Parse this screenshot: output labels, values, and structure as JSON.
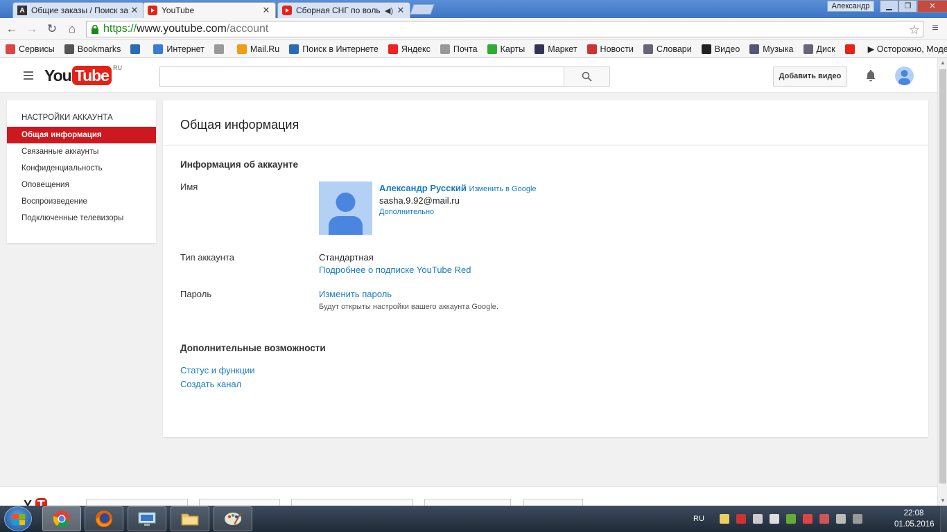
{
  "browser": {
    "tabs": [
      {
        "label": "Общие заказы / Поиск за",
        "active": false
      },
      {
        "label": "YouTube",
        "active": true
      },
      {
        "label": "Сборная СНГ по воль",
        "active": false
      }
    ],
    "user_chip": "Александр",
    "url": {
      "scheme": "https://",
      "host": "www.youtube.com",
      "path": "/account"
    },
    "bookmarks": [
      {
        "label": "Сервисы",
        "icon": "apps-icon",
        "color": "#d44"
      },
      {
        "label": "Bookmarks",
        "icon": "star-icon",
        "color": "#555"
      },
      {
        "label": "",
        "icon": "sb-icon",
        "color": "#2a6bb8"
      },
      {
        "label": "Интернет",
        "icon": "globe-icon",
        "color": "#3a7bd5"
      },
      {
        "label": "",
        "icon": "page-icon",
        "color": "#999"
      },
      {
        "label": "Mail.Ru",
        "icon": "mailru-icon",
        "color": "#f39c12"
      },
      {
        "label": "Поиск в Интернете",
        "icon": "search-icon",
        "color": "#2a6bb8"
      },
      {
        "label": "Яндекс",
        "icon": "yandex-icon",
        "color": "#e22"
      },
      {
        "label": "Почта",
        "icon": "page-icon",
        "color": "#999"
      },
      {
        "label": "Карты",
        "icon": "maps-icon",
        "color": "#3a3"
      },
      {
        "label": "Маркет",
        "icon": "cart-icon",
        "color": "#335"
      },
      {
        "label": "Новости",
        "icon": "news-icon",
        "color": "#c33"
      },
      {
        "label": "Словари",
        "icon": "dict-icon",
        "color": "#667"
      },
      {
        "label": "Видео",
        "icon": "video-icon",
        "color": "#222"
      },
      {
        "label": "Музыка",
        "icon": "music-icon",
        "color": "#557"
      },
      {
        "label": "Диск",
        "icon": "disk-icon",
        "color": "#667"
      },
      {
        "label": "",
        "icon": "youtube-icon",
        "color": "#e62117"
      },
      {
        "label": "▶ Осторожно, Моде",
        "icon": "",
        "color": ""
      }
    ]
  },
  "masthead": {
    "logo_you": "You",
    "logo_tube": "Tube",
    "logo_region": "RU",
    "search_placeholder": "",
    "upload_label": "Добавить видео"
  },
  "sidebar": {
    "title": "НАСТРОЙКИ АККАУНТА",
    "items": [
      {
        "label": "Общая информация",
        "active": true
      },
      {
        "label": "Связанные аккаунты",
        "active": false
      },
      {
        "label": "Конфиденциальность",
        "active": false
      },
      {
        "label": "Оповещения",
        "active": false
      },
      {
        "label": "Воспроизведение",
        "active": false
      },
      {
        "label": "Подключенные телевизоры",
        "active": false
      }
    ]
  },
  "main": {
    "title": "Общая информация",
    "account_section": "Информация об аккаунте",
    "name_label": "Имя",
    "user_name": "Александр Русский",
    "edit_in_google": "Изменить в Google",
    "email": "sasha.9.92@mail.ru",
    "more": "Дополнительно",
    "account_type_label": "Тип аккаунта",
    "account_type": "Стандартная",
    "red_link": "Подробнее о подписке YouTube Red",
    "password_label": "Пароль",
    "change_password": "Изменить пароль",
    "password_note": "Будут открыты настройки вашего аккаунта Google.",
    "extra_section": "Дополнительные возможности",
    "status_link": "Статус и функции",
    "create_channel_link": "Создать канал"
  },
  "taskbar": {
    "language": "RU",
    "time": "22:08",
    "date": "01.05.2016"
  },
  "colors": {
    "accent": "#cc181e",
    "link": "#167ac6",
    "avatar_bg": "#b4d1f5",
    "avatar_fg": "#4a86e0"
  }
}
